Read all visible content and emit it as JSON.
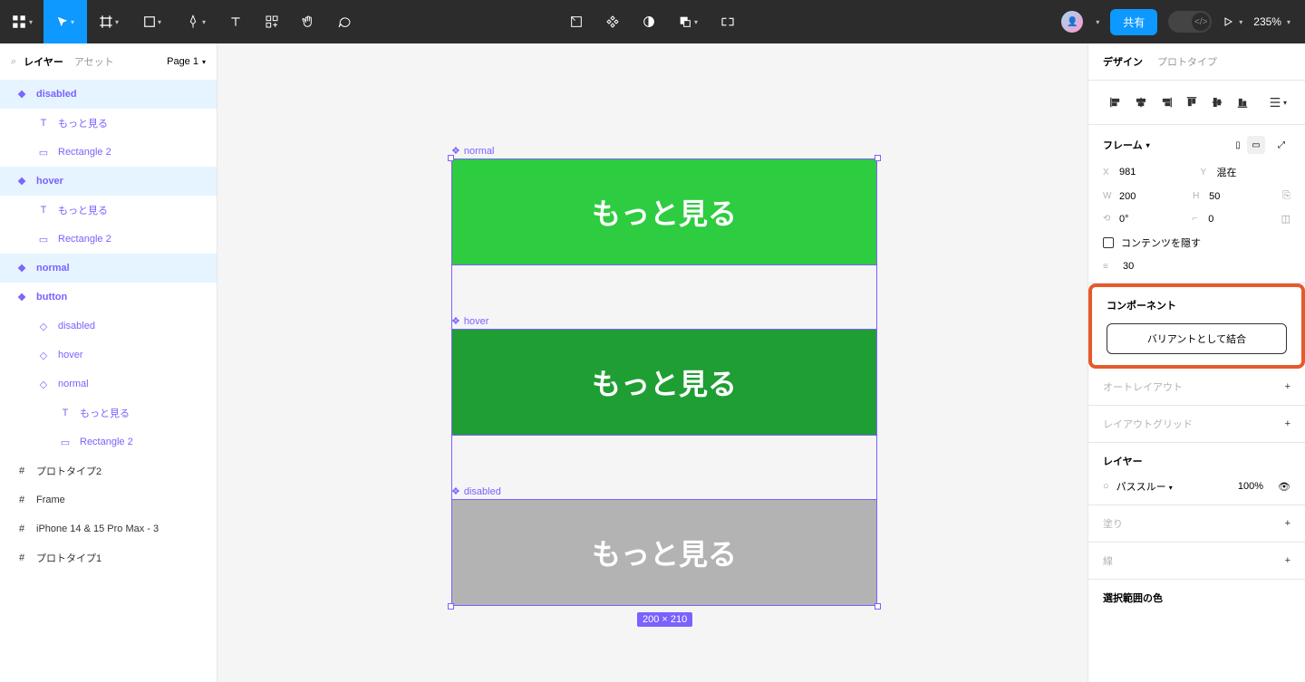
{
  "toolbar": {
    "zoom": "235%",
    "share": "共有"
  },
  "leftPanel": {
    "layersTab": "レイヤー",
    "assetsTab": "アセット",
    "pageLabel": "Page 1",
    "layers": {
      "disabled": "disabled",
      "more1": "もっと見る",
      "rect1": "Rectangle 2",
      "hover": "hover",
      "more2": "もっと見る",
      "rect2": "Rectangle 2",
      "normal": "normal",
      "button": "button",
      "bdisabled": "disabled",
      "bhover": "hover",
      "bnormal": "normal",
      "more3": "もっと見る",
      "rect3": "Rectangle 2",
      "proto2": "プロトタイプ2",
      "frame": "Frame",
      "iphone": "iPhone 14 & 15 Pro Max - 3",
      "proto1": "プロトタイプ1"
    }
  },
  "canvas": {
    "labelNormal": "normal",
    "labelHover": "hover",
    "labelDisabled": "disabled",
    "btnText": "もっと見る",
    "dims": "200 × 210"
  },
  "rightPanel": {
    "designTab": "デザイン",
    "protoTab": "プロトタイプ",
    "frameTitle": "フレーム",
    "x": "981",
    "yLabel": "混在",
    "w": "200",
    "h": "50",
    "rotation": "0°",
    "radius": "0",
    "clipContent": "コンテンツを隠す",
    "gap": "30",
    "componentTitle": "コンポーネント",
    "combineVariants": "バリアントとして結合",
    "autoLayout": "オートレイアウト",
    "layoutGrid": "レイアウトグリッド",
    "layerTitle": "レイヤー",
    "blendMode": "パススルー",
    "opacity": "100%",
    "fill": "塗り",
    "stroke": "線",
    "selectionColors": "選択範囲の色"
  }
}
